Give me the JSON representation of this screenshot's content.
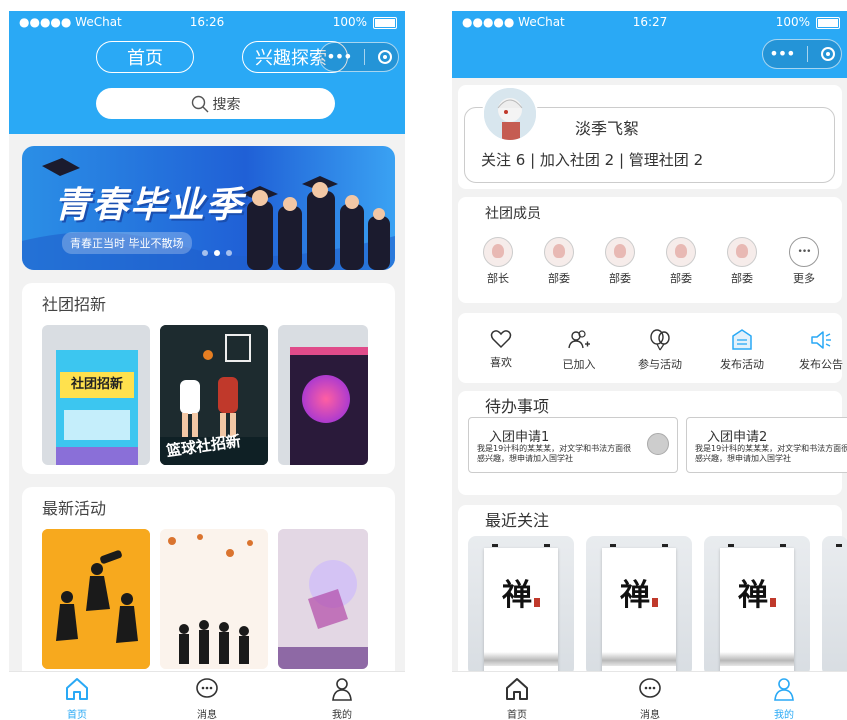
{
  "status_left": {
    "carrier": "●●●●● WeChat",
    "time": "16:26",
    "battery": "100%"
  },
  "status_right": {
    "carrier": "●●●●● WeChat",
    "time": "16:27",
    "battery": "100%"
  },
  "home": {
    "tab_home": "首页",
    "tab_explore": "兴趣探索",
    "search_label": "搜索",
    "banner": {
      "title": "青春毕业季",
      "subtitle": "青春正当时 毕业不散场"
    },
    "section_recruit": {
      "title": "社团招新",
      "poster1_title": "社团招新",
      "poster2_title": "篮球社招新"
    },
    "section_activity": {
      "title": "最新活动"
    }
  },
  "mine": {
    "username": "淡季飞絮",
    "stats": "关注 6 | 加入社团 2 | 管理社团 2",
    "members_title": "社团成员",
    "members": [
      "部长",
      "部委",
      "部委",
      "部委",
      "部委",
      "更多"
    ],
    "features": [
      {
        "label": "喜欢",
        "icon": "heart-icon"
      },
      {
        "label": "已加入",
        "icon": "users-add-icon"
      },
      {
        "label": "参与活动",
        "icon": "balloons-icon"
      },
      {
        "label": "发布活动",
        "icon": "calendar-icon"
      },
      {
        "label": "发布公告",
        "icon": "megaphone-icon"
      }
    ],
    "todo_title": "待办事项",
    "todos": [
      {
        "title": "入团申请1",
        "desc": "我是19计科的某某某，对文学和书法方面很感兴趣，想申请加入国学社"
      },
      {
        "title": "入团申请2",
        "desc": "我是19计科的某某某，对文学和书法方面很感兴趣，想申请加入国学社"
      }
    ],
    "recent_title": "最近关注",
    "poster_char": "禅"
  },
  "tabbar": {
    "home": "首页",
    "messages": "消息",
    "mine": "我的"
  },
  "colors": {
    "primary": "#2aa9f5"
  }
}
